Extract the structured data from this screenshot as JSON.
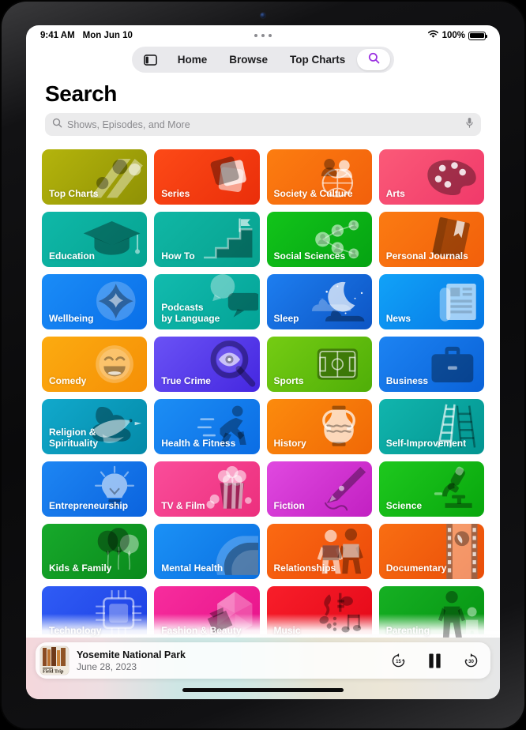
{
  "status_bar": {
    "time": "9:41 AM",
    "date": "Mon Jun 10",
    "battery_percent": "100%",
    "wifi_icon": "wifi-icon",
    "battery_icon": "battery-full-icon"
  },
  "tab_bar": {
    "sidebar_icon": "sidebar-toggle-icon",
    "tabs": [
      {
        "label": "Home"
      },
      {
        "label": "Browse"
      },
      {
        "label": "Top Charts"
      }
    ],
    "search_icon": "search-icon",
    "search_selected": true,
    "accent_color": "#9b30e0"
  },
  "page": {
    "title": "Search",
    "search": {
      "placeholder": "Shows, Episodes, and More",
      "value": "",
      "leading_icon": "search-icon",
      "trailing_icon": "microphone-icon"
    }
  },
  "categories": [
    {
      "label": "Top Charts",
      "icon": "chart-dots-icon",
      "c1": "#b4b40c",
      "c2": "#8f9105"
    },
    {
      "label": "Series",
      "icon": "stacked-cards-icon",
      "c1": "#fd4a17",
      "c2": "#ea2e0a"
    },
    {
      "label": "Society & Culture",
      "icon": "globe-people-icon",
      "c1": "#fc7d10",
      "c2": "#f2600c"
    },
    {
      "label": "Arts",
      "icon": "paint-palette-icon",
      "c1": "#fb5a78",
      "c2": "#f0396a"
    },
    {
      "label": "Education",
      "icon": "graduation-cap-icon",
      "c1": "#0fb8a8",
      "c2": "#06a391"
    },
    {
      "label": "How To",
      "icon": "stairs-flag-icon",
      "c1": "#10b7a5",
      "c2": "#07a18f"
    },
    {
      "label": "Social Sciences",
      "icon": "network-people-icon",
      "c1": "#12c41a",
      "c2": "#05a312"
    },
    {
      "label": "Personal Journals",
      "icon": "book-bookmark-icon",
      "c1": "#fb7b12",
      "c2": "#f25f0b"
    },
    {
      "label": "Wellbeing",
      "icon": "flower-wellbeing-icon",
      "c1": "#1a8cf7",
      "c2": "#0a6fe8"
    },
    {
      "label": "Podcasts\nby Language",
      "icon": "speech-bubbles-icon",
      "c1": "#12bbae",
      "c2": "#03a396"
    },
    {
      "label": "Sleep",
      "icon": "moon-clouds-icon",
      "c1": "#1d7ef0",
      "c2": "#0d55c4"
    },
    {
      "label": "News",
      "icon": "newspaper-icon",
      "c1": "#11a2f8",
      "c2": "#0678e5"
    },
    {
      "label": "Comedy",
      "icon": "laughing-face-icon",
      "c1": "#fcab10",
      "c2": "#f58f06"
    },
    {
      "label": "True Crime",
      "icon": "magnifier-eye-icon",
      "c1": "#6a52f5",
      "c2": "#4527e0"
    },
    {
      "label": "Sports",
      "icon": "soccer-field-icon",
      "c1": "#75cc13",
      "c2": "#4fae08"
    },
    {
      "label": "Business",
      "icon": "briefcase-icon",
      "c1": "#1c83f2",
      "c2": "#0a62d8"
    },
    {
      "label": "Religion &\nSpirituality",
      "icon": "dove-icon",
      "c1": "#11a9cc",
      "c2": "#048aa8"
    },
    {
      "label": "Health & Fitness",
      "icon": "runner-icon",
      "c1": "#1c8ef5",
      "c2": "#0b6de4"
    },
    {
      "label": "History",
      "icon": "amphora-icon",
      "c1": "#fc8b0d",
      "c2": "#f06806"
    },
    {
      "label": "Self-Improvement",
      "icon": "ladders-icon",
      "c1": "#11b5ad",
      "c2": "#039591"
    },
    {
      "label": "Entrepreneurship",
      "icon": "lightbulb-icon",
      "c1": "#1d86f3",
      "c2": "#0b63de"
    },
    {
      "label": "TV & Film",
      "icon": "popcorn-icon",
      "c1": "#fa4d9a",
      "c2": "#ec2f7d"
    },
    {
      "label": "Fiction",
      "icon": "fountain-pen-icon",
      "c1": "#e049e0",
      "c2": "#c220c2"
    },
    {
      "label": "Science",
      "icon": "microscope-icon",
      "c1": "#1ec81e",
      "c2": "#08a70d"
    },
    {
      "label": "Kids & Family",
      "icon": "balloons-icon",
      "c1": "#17a92b",
      "c2": "#0a8a1c"
    },
    {
      "label": "Mental Health",
      "icon": "head-profile-icon",
      "c1": "#1b91f6",
      "c2": "#0a6fe0"
    },
    {
      "label": "Relationships",
      "icon": "two-people-icon",
      "c1": "#fb6a12",
      "c2": "#ec4a0a"
    },
    {
      "label": "Documentary",
      "icon": "film-strip-icon",
      "c1": "#f96e12",
      "c2": "#e94d09"
    },
    {
      "label": "Technology",
      "icon": "microchip-icon",
      "c1": "#2f5cf5",
      "c2": "#1d3fe3"
    },
    {
      "label": "Fashion & Beauty",
      "icon": "parasol-icon",
      "c1": "#f72d9d",
      "c2": "#e7138a"
    },
    {
      "label": "Music",
      "icon": "music-notes-icon",
      "c1": "#f81e2a",
      "c2": "#e40818"
    },
    {
      "label": "Parenting",
      "icon": "parent-child-icon",
      "c1": "#16b023",
      "c2": "#059412"
    }
  ],
  "now_playing": {
    "artwork_caption": "Field Trip",
    "title": "Yosemite National Park",
    "subtitle": "June 28, 2023",
    "skip_back_label": "15",
    "skip_forward_label": "30",
    "skip_back_icon": "skip-back-15-icon",
    "play_pause_icon": "pause-icon",
    "skip_forward_icon": "skip-forward-30-icon",
    "is_playing": true
  }
}
